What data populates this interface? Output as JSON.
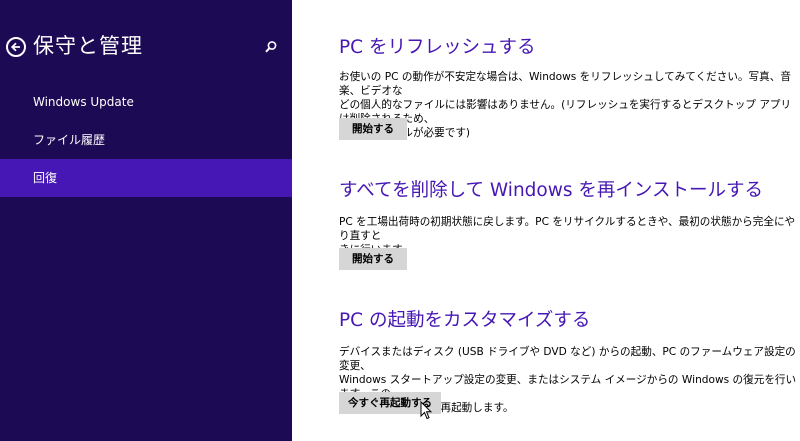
{
  "sidebar": {
    "title": "保守と管理",
    "back_icon": "back-arrow-icon",
    "search_icon": "search-icon",
    "items": [
      {
        "label": "Windows Update"
      },
      {
        "label": "ファイル履歴"
      },
      {
        "label": "回復",
        "selected": true
      }
    ]
  },
  "main": {
    "sections": [
      {
        "title": "PC をリフレッシュする",
        "description_lines": [
          "お使いの PC の動作が不安定な場合は、Windows をリフレッシュしてみてください。写真、音楽、ビデオな",
          "どの個人的なファイルには影響はありません。(リフレッシュを実行するとデスクトップ アプリは削除されるため、",
          "再インストールが必要です)"
        ],
        "button": "開始する"
      },
      {
        "title": "すべてを削除して Windows を再インストールする",
        "description_lines": [
          "PC を工場出荷時の初期状態に戻します。PC をリサイクルするときや、最初の状態から完全にやり直すと",
          "きに行います。"
        ],
        "button": "開始する"
      },
      {
        "title": "PC の起動をカスタマイズする",
        "description_lines": [
          "デバイスまたはディスク (USB ドライブや DVD など) からの起動、PC のファームウェア設定の変更、",
          "Windows スタートアップ設定の変更、またはシステム イメージからの Windows の復元を行います。この",
          "操作を行うと、PC が再起動します。"
        ],
        "button": "今すぐ再起動する"
      }
    ]
  },
  "colors": {
    "sidebar_bg": "#1c0a54",
    "selected_bg": "#4617b4",
    "accent_text": "#4617b4",
    "button_bg": "#d6d6d6"
  }
}
